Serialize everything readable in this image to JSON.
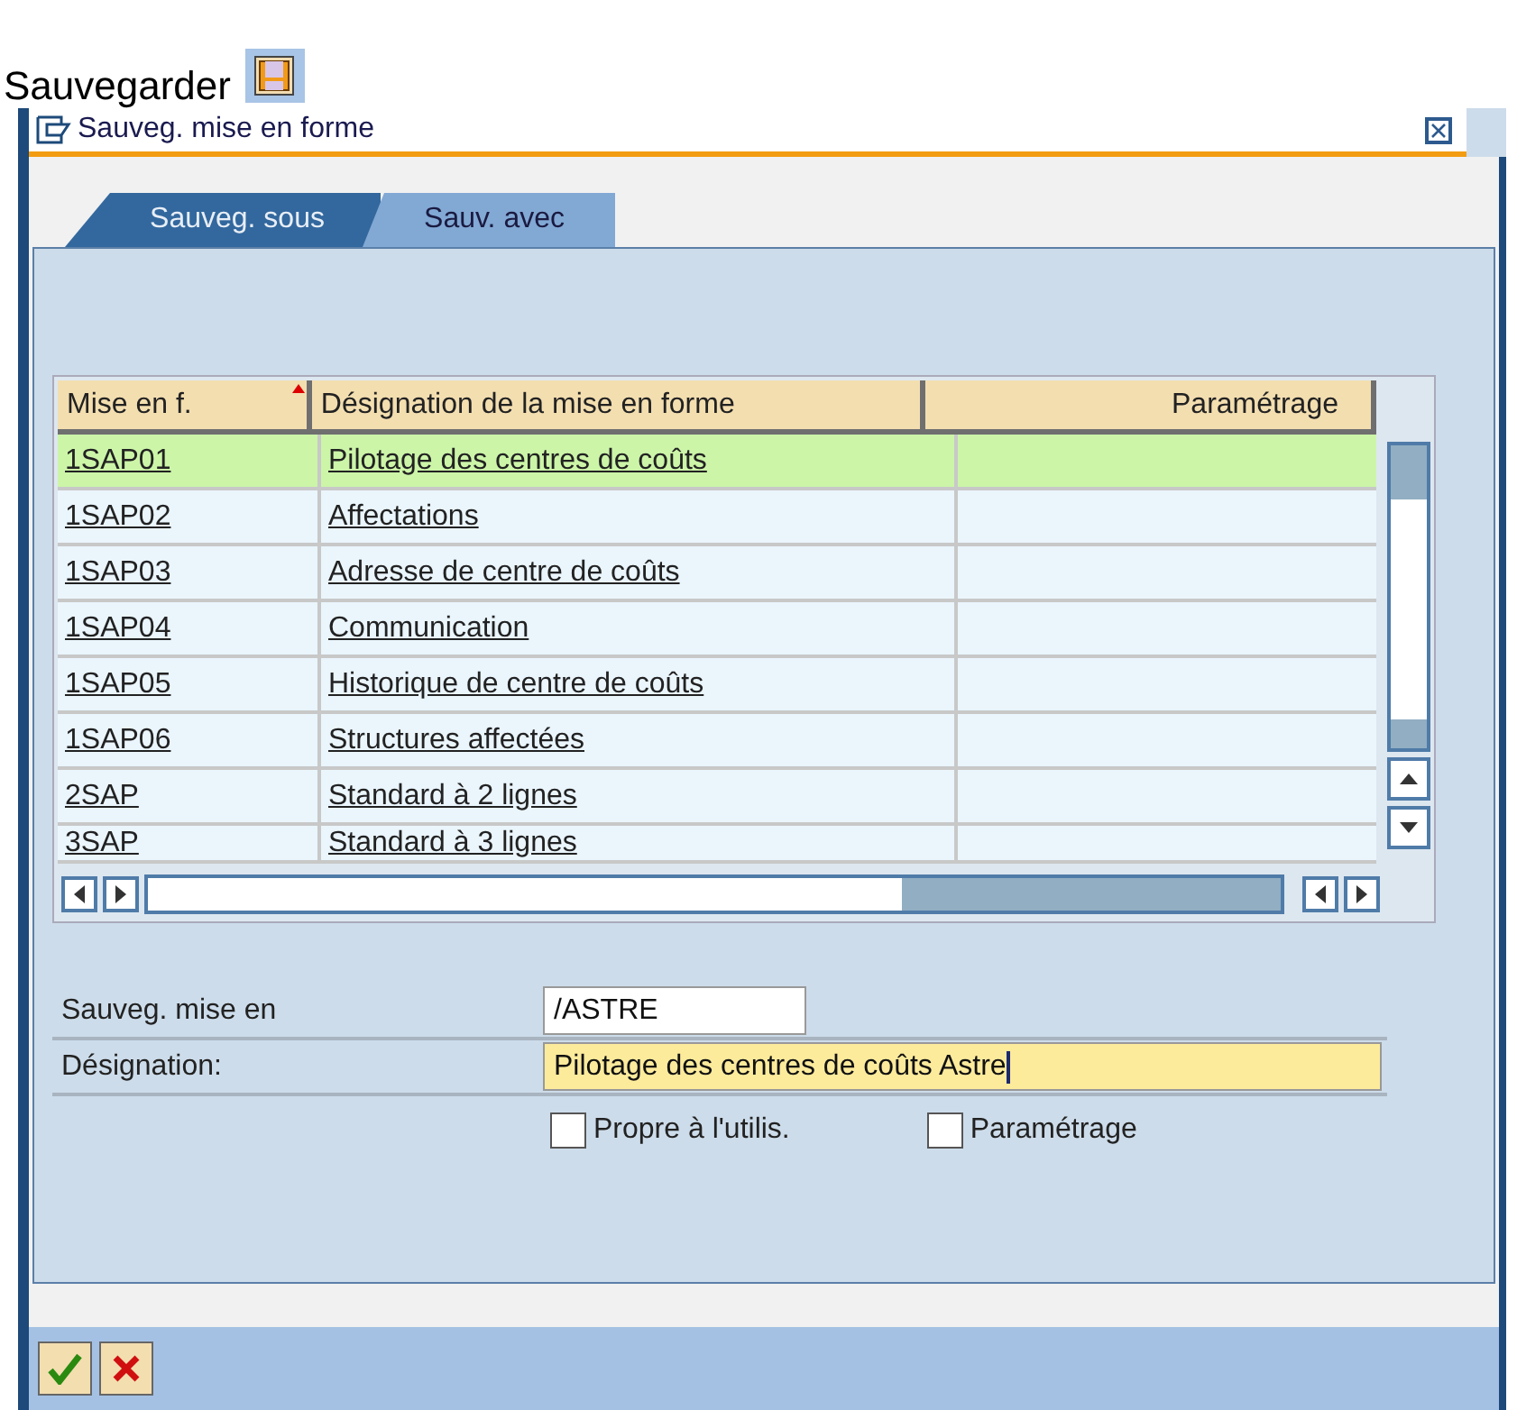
{
  "page_title": "Sauvegarder",
  "window": {
    "title": "Sauveg. mise en forme"
  },
  "tabs": [
    {
      "label": "Sauveg. sous",
      "selected": true
    },
    {
      "label": "Sauv. avec",
      "selected": false
    }
  ],
  "table": {
    "columns": [
      "Mise en f.",
      "Désignation de la mise en forme",
      "Paramétrage"
    ],
    "rows": [
      {
        "cells": [
          "1SAP01",
          "Pilotage des centres de coûts",
          ""
        ],
        "selected": true
      },
      {
        "cells": [
          "1SAP02",
          "Affectations",
          ""
        ],
        "selected": false
      },
      {
        "cells": [
          "1SAP03",
          "Adresse de centre de coûts",
          ""
        ],
        "selected": false
      },
      {
        "cells": [
          "1SAP04",
          "Communication",
          ""
        ],
        "selected": false
      },
      {
        "cells": [
          "1SAP05",
          "Historique de centre de coûts",
          ""
        ],
        "selected": false
      },
      {
        "cells": [
          "1SAP06",
          "Structures affectées",
          ""
        ],
        "selected": false
      },
      {
        "cells": [
          "2SAP",
          "Standard à 2 lignes",
          ""
        ],
        "selected": false
      },
      {
        "cells": [
          "3SAP",
          "Standard à 3 lignes",
          ""
        ],
        "selected": false
      }
    ]
  },
  "form": {
    "fields": [
      {
        "label": "Sauveg. mise en",
        "value": "/ASTRE",
        "focused": false
      },
      {
        "label": "Désignation:",
        "value": "Pilotage des centres de coûts Astre",
        "focused": true
      }
    ],
    "checkboxes": [
      {
        "label": "Propre à l'utilis.",
        "checked": false
      },
      {
        "label": "Paramétrage",
        "checked": false
      }
    ]
  }
}
